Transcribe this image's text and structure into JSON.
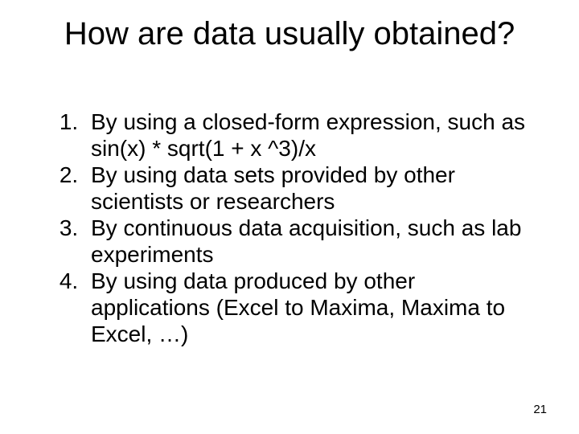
{
  "title": "How are data usually obtained?",
  "items": [
    "By using a closed-form expression, such as sin(x) * sqrt(1 + x ^3)/x",
    "By using data sets provided by other scientists or researchers",
    "By continuous data acquisition, such as lab experiments",
    "By using data produced by other applications (Excel to Maxima, Maxima to Excel, …)"
  ],
  "page_number": "21"
}
